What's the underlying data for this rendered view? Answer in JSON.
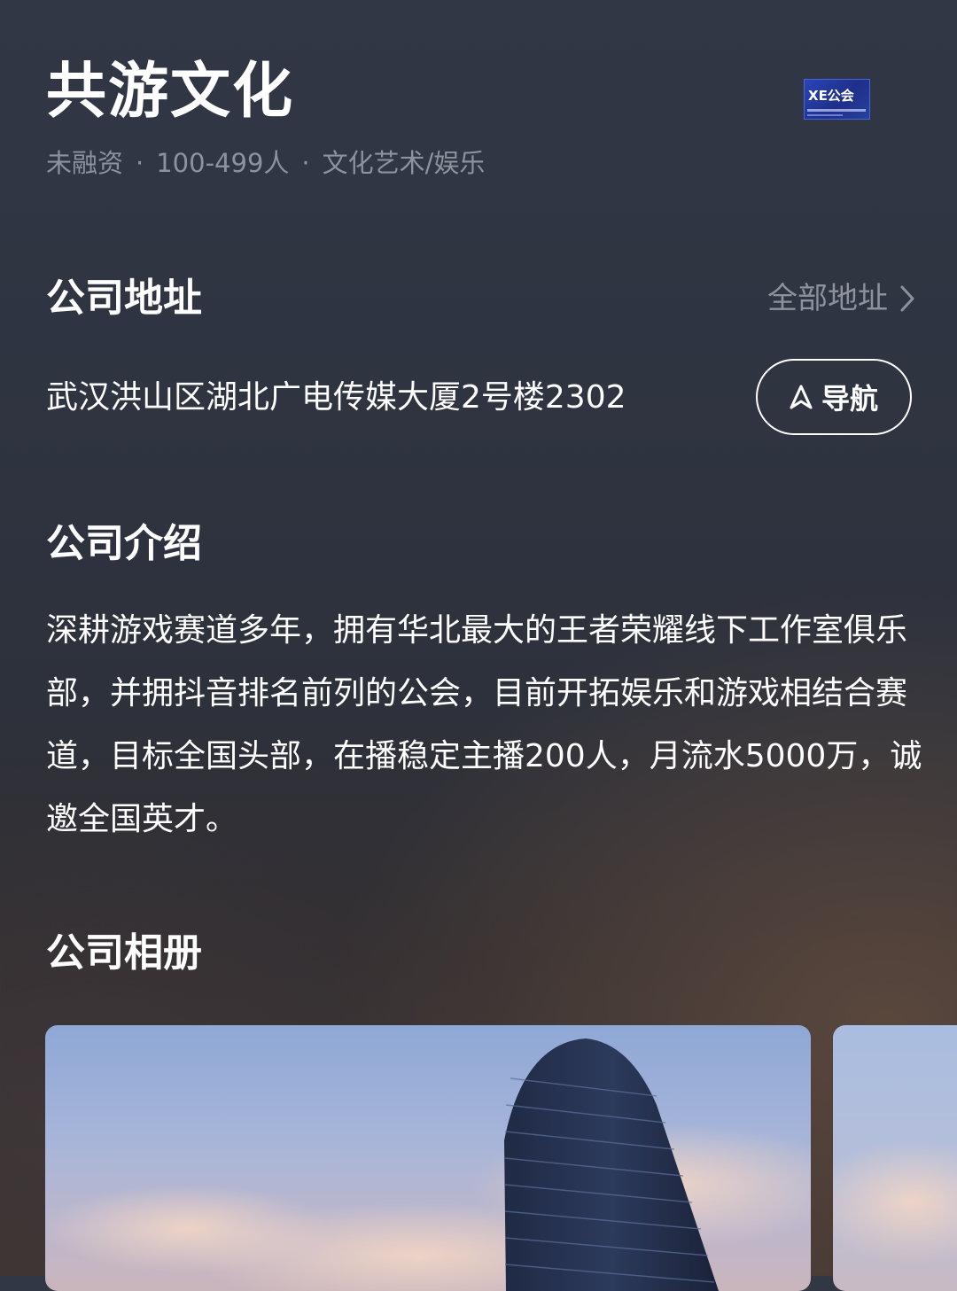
{
  "company": {
    "name": "共游文化",
    "meta": [
      "未融资",
      "100-499人",
      "文化艺术/娱乐"
    ],
    "meta_separator": "·",
    "logo_text": "XE公会"
  },
  "address_section": {
    "title": "公司地址",
    "all_link": "全部地址",
    "address": "武汉洪山区湖北广电传媒大厦2号楼2302",
    "nav_button": "导航"
  },
  "intro_section": {
    "title": "公司介绍",
    "text": "深耕游戏赛道多年，拥有华北最大的王者荣耀线下工作室俱乐部，并拥抖音排名前列的公会，目前开拓娱乐和游戏相结合赛道，目标全国头部，在播稳定主播200人，月流水5000万，诚邀全国英才。"
  },
  "album_section": {
    "title": "公司相册",
    "photos": [
      "building-photo",
      "building-photo"
    ]
  },
  "colors": {
    "text_primary": "#ffffff",
    "text_secondary": "#8d929d",
    "logo_blue": "#2a45b8"
  }
}
